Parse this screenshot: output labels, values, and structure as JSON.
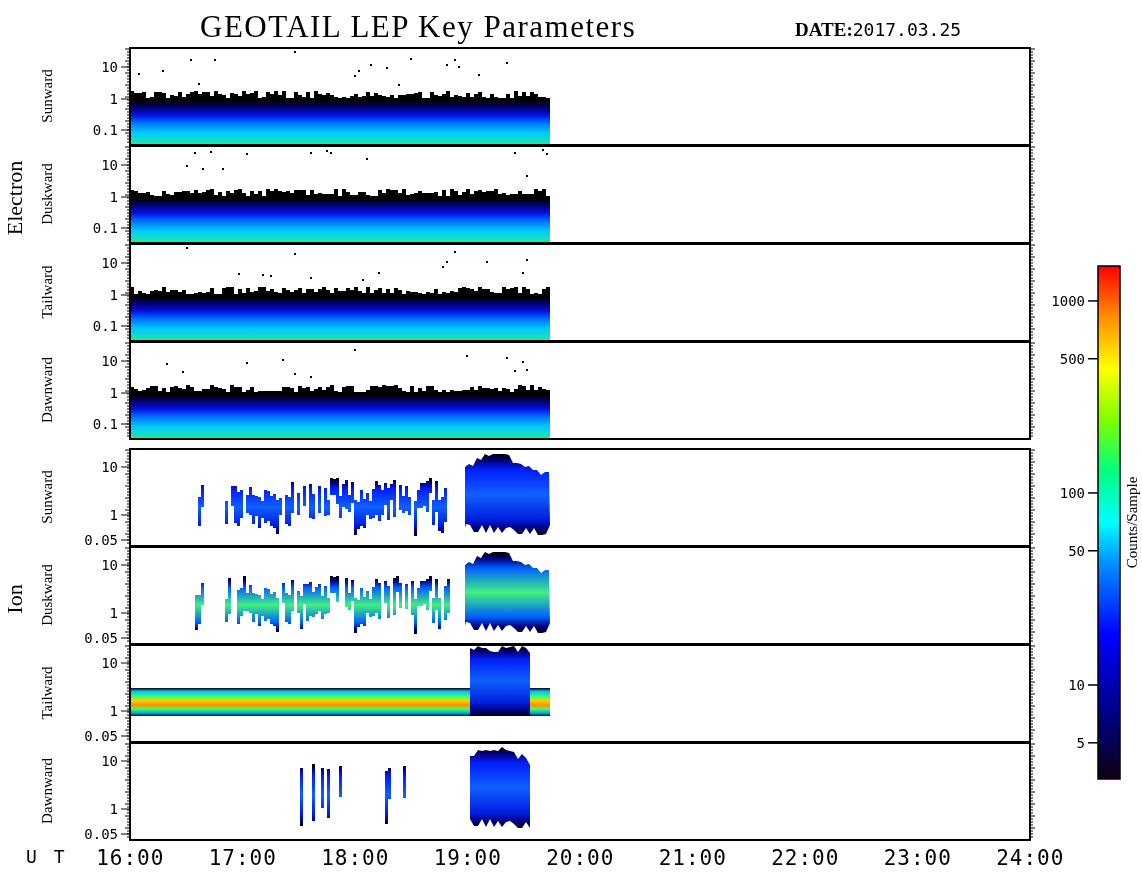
{
  "title": "GEOTAIL LEP Key Parameters",
  "date_label": "DATE:",
  "date": "2017.03.25",
  "groups": [
    {
      "label": "Electron",
      "kind": "electron",
      "panels": [
        {
          "label": "Sunward",
          "kind": "uniform",
          "yticks": [
            "10",
            "1",
            "0.1"
          ]
        },
        {
          "label": "Duskward",
          "kind": "uniform",
          "yticks": [
            "10",
            "1",
            "0.1"
          ]
        },
        {
          "label": "Tailward",
          "kind": "uniform",
          "yticks": [
            "10",
            "1",
            "0.1"
          ]
        },
        {
          "label": "Dawnward",
          "kind": "uniform",
          "yticks": [
            "10",
            "1",
            "0.1"
          ]
        }
      ]
    },
    {
      "label": "Ion",
      "kind": "ion",
      "panels": [
        {
          "label": "Sunward",
          "kind": "patchy",
          "yticks": [
            "10",
            "1",
            "0.05"
          ]
        },
        {
          "label": "Duskward",
          "kind": "patchy",
          "yticks": [
            "10",
            "1",
            "0.05"
          ]
        },
        {
          "label": "Tailward",
          "kind": "beam",
          "yticks": [
            "10",
            "1",
            "0.05"
          ]
        },
        {
          "label": "Dawnward",
          "kind": "sparse",
          "yticks": [
            "10",
            "1",
            "0.05"
          ]
        }
      ]
    }
  ],
  "x_axis": {
    "label": "U T",
    "ticks": [
      "16:00",
      "17:00",
      "18:00",
      "19:00",
      "20:00",
      "21:00",
      "22:00",
      "23:00",
      "24:00"
    ]
  },
  "color_scale": {
    "label": "Counts/Sample",
    "ticks": [
      "1000",
      "500",
      "100",
      "50",
      "10",
      "5"
    ]
  }
}
